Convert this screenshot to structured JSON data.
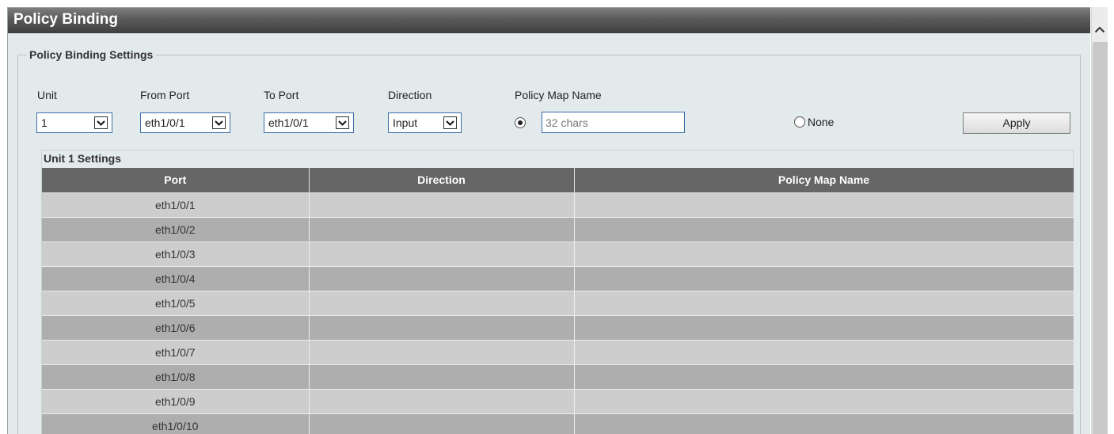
{
  "page": {
    "title": "Policy Binding"
  },
  "settings": {
    "legend": "Policy Binding Settings",
    "unit": {
      "label": "Unit",
      "value": "1"
    },
    "from_port": {
      "label": "From Port",
      "value": "eth1/0/1"
    },
    "to_port": {
      "label": "To Port",
      "value": "eth1/0/1"
    },
    "direction": {
      "label": "Direction",
      "value": "Input"
    },
    "policy_map": {
      "label": "Policy Map Name",
      "placeholder": "32 chars",
      "selected": true
    },
    "none_label": "None",
    "apply_label": "Apply"
  },
  "table": {
    "title": "Unit 1 Settings",
    "columns": [
      "Port",
      "Direction",
      "Policy Map Name"
    ],
    "rows": [
      {
        "port": "eth1/0/1",
        "direction": "",
        "policy": ""
      },
      {
        "port": "eth1/0/2",
        "direction": "",
        "policy": ""
      },
      {
        "port": "eth1/0/3",
        "direction": "",
        "policy": ""
      },
      {
        "port": "eth1/0/4",
        "direction": "",
        "policy": ""
      },
      {
        "port": "eth1/0/5",
        "direction": "",
        "policy": ""
      },
      {
        "port": "eth1/0/6",
        "direction": "",
        "policy": ""
      },
      {
        "port": "eth1/0/7",
        "direction": "",
        "policy": ""
      },
      {
        "port": "eth1/0/8",
        "direction": "",
        "policy": ""
      },
      {
        "port": "eth1/0/9",
        "direction": "",
        "policy": ""
      },
      {
        "port": "eth1/0/10",
        "direction": "",
        "policy": ""
      }
    ]
  },
  "icons": {
    "scroll_up": "chevron-up-icon",
    "dropdown": "chevron-down-icon"
  }
}
